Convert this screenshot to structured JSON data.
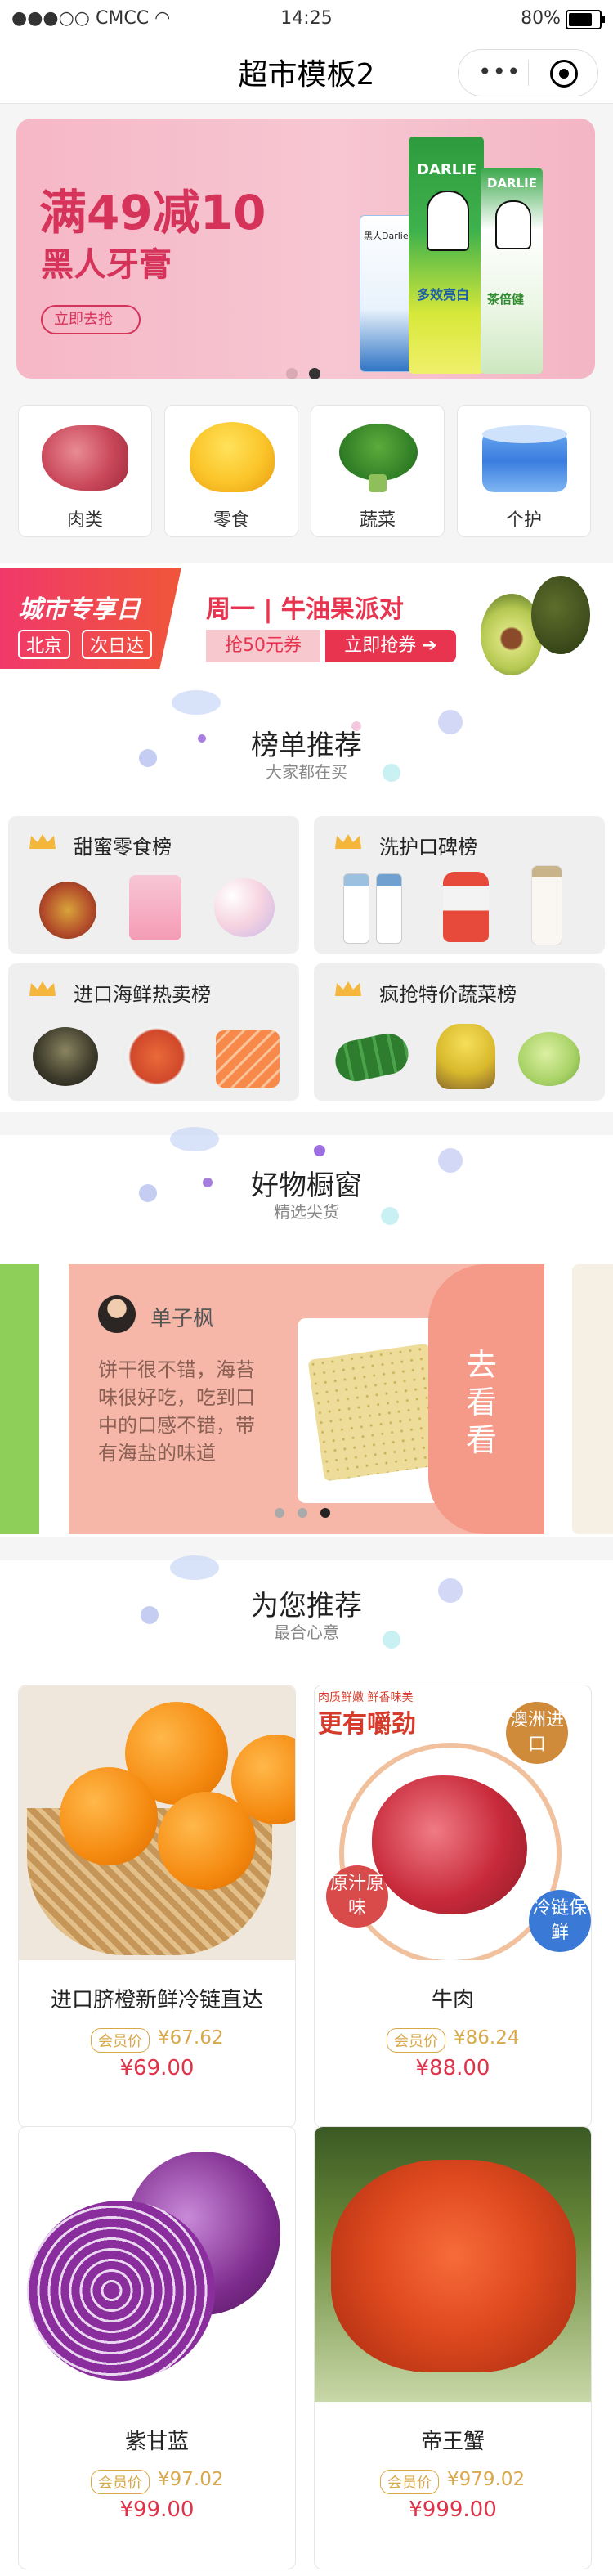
{
  "status_bar": {
    "signal": "●●●○○",
    "carrier": "CMCC",
    "time": "14:25",
    "battery": "80%"
  },
  "nav": {
    "title": "超市模板2"
  },
  "banner": {
    "headline": "满49减10",
    "product": "黑人牙膏",
    "button": "立即去抢",
    "pack_brand": "DARLIE",
    "pack_text_1": "多效亮白",
    "pack_text_2": "茶倍健",
    "pack_small": "黑人Darlie"
  },
  "categories": [
    {
      "label": "肉类",
      "icon": "meat-icon"
    },
    {
      "label": "零食",
      "icon": "mango-icon"
    },
    {
      "label": "蔬菜",
      "icon": "broccoli-icon"
    },
    {
      "label": "个护",
      "icon": "cream-jar-icon"
    }
  ],
  "promo": {
    "tag_top": "城市专享日",
    "city": "北京",
    "day": "次日达",
    "headline": "周一 | 牛油果派对",
    "coupon": "抢50元券",
    "cta": "立即抢券 ➔"
  },
  "rankings": {
    "title": "榜单推荐",
    "subtitle": "大家都在买",
    "boards": [
      {
        "name": "甜蜜零食榜"
      },
      {
        "name": "洗护口碑榜"
      },
      {
        "name": "进口海鲜热卖榜"
      },
      {
        "name": "疯抢特价蔬菜榜"
      }
    ]
  },
  "showcase": {
    "title": "好物橱窗",
    "subtitle": "精选尖货",
    "card": {
      "author": "单子枫",
      "review": "饼干很不错，海苔味很好吃，吃到口中的口感不错，带有海盐的味道",
      "cta": "去看看"
    }
  },
  "recommend": {
    "title": "为您推荐",
    "subtitle": "最合心意",
    "member_label": "会员价",
    "products": [
      {
        "name": "进口脐橙新鲜冷链直达",
        "member_price": "¥67.62",
        "price": "¥69.00"
      },
      {
        "name": "牛肉",
        "member_price": "¥86.24",
        "price": "¥88.00",
        "tag_top": "肉质鲜嫩 鲜香味美",
        "headline": "更有嚼劲",
        "badge1": "澳洲进口",
        "badge2": "原汁原味",
        "badge3": "冷链保鲜"
      },
      {
        "name": "紫甘蓝",
        "member_price": "¥97.02",
        "price": "¥99.00"
      },
      {
        "name": "帝王蟹",
        "member_price": "¥979.02",
        "price": "¥999.00"
      }
    ]
  },
  "colors": {
    "accent_red": "#e0334a",
    "banner_pink": "#f6b7c6",
    "gold": "#d9a84a",
    "promo_red": "#e8344e"
  }
}
